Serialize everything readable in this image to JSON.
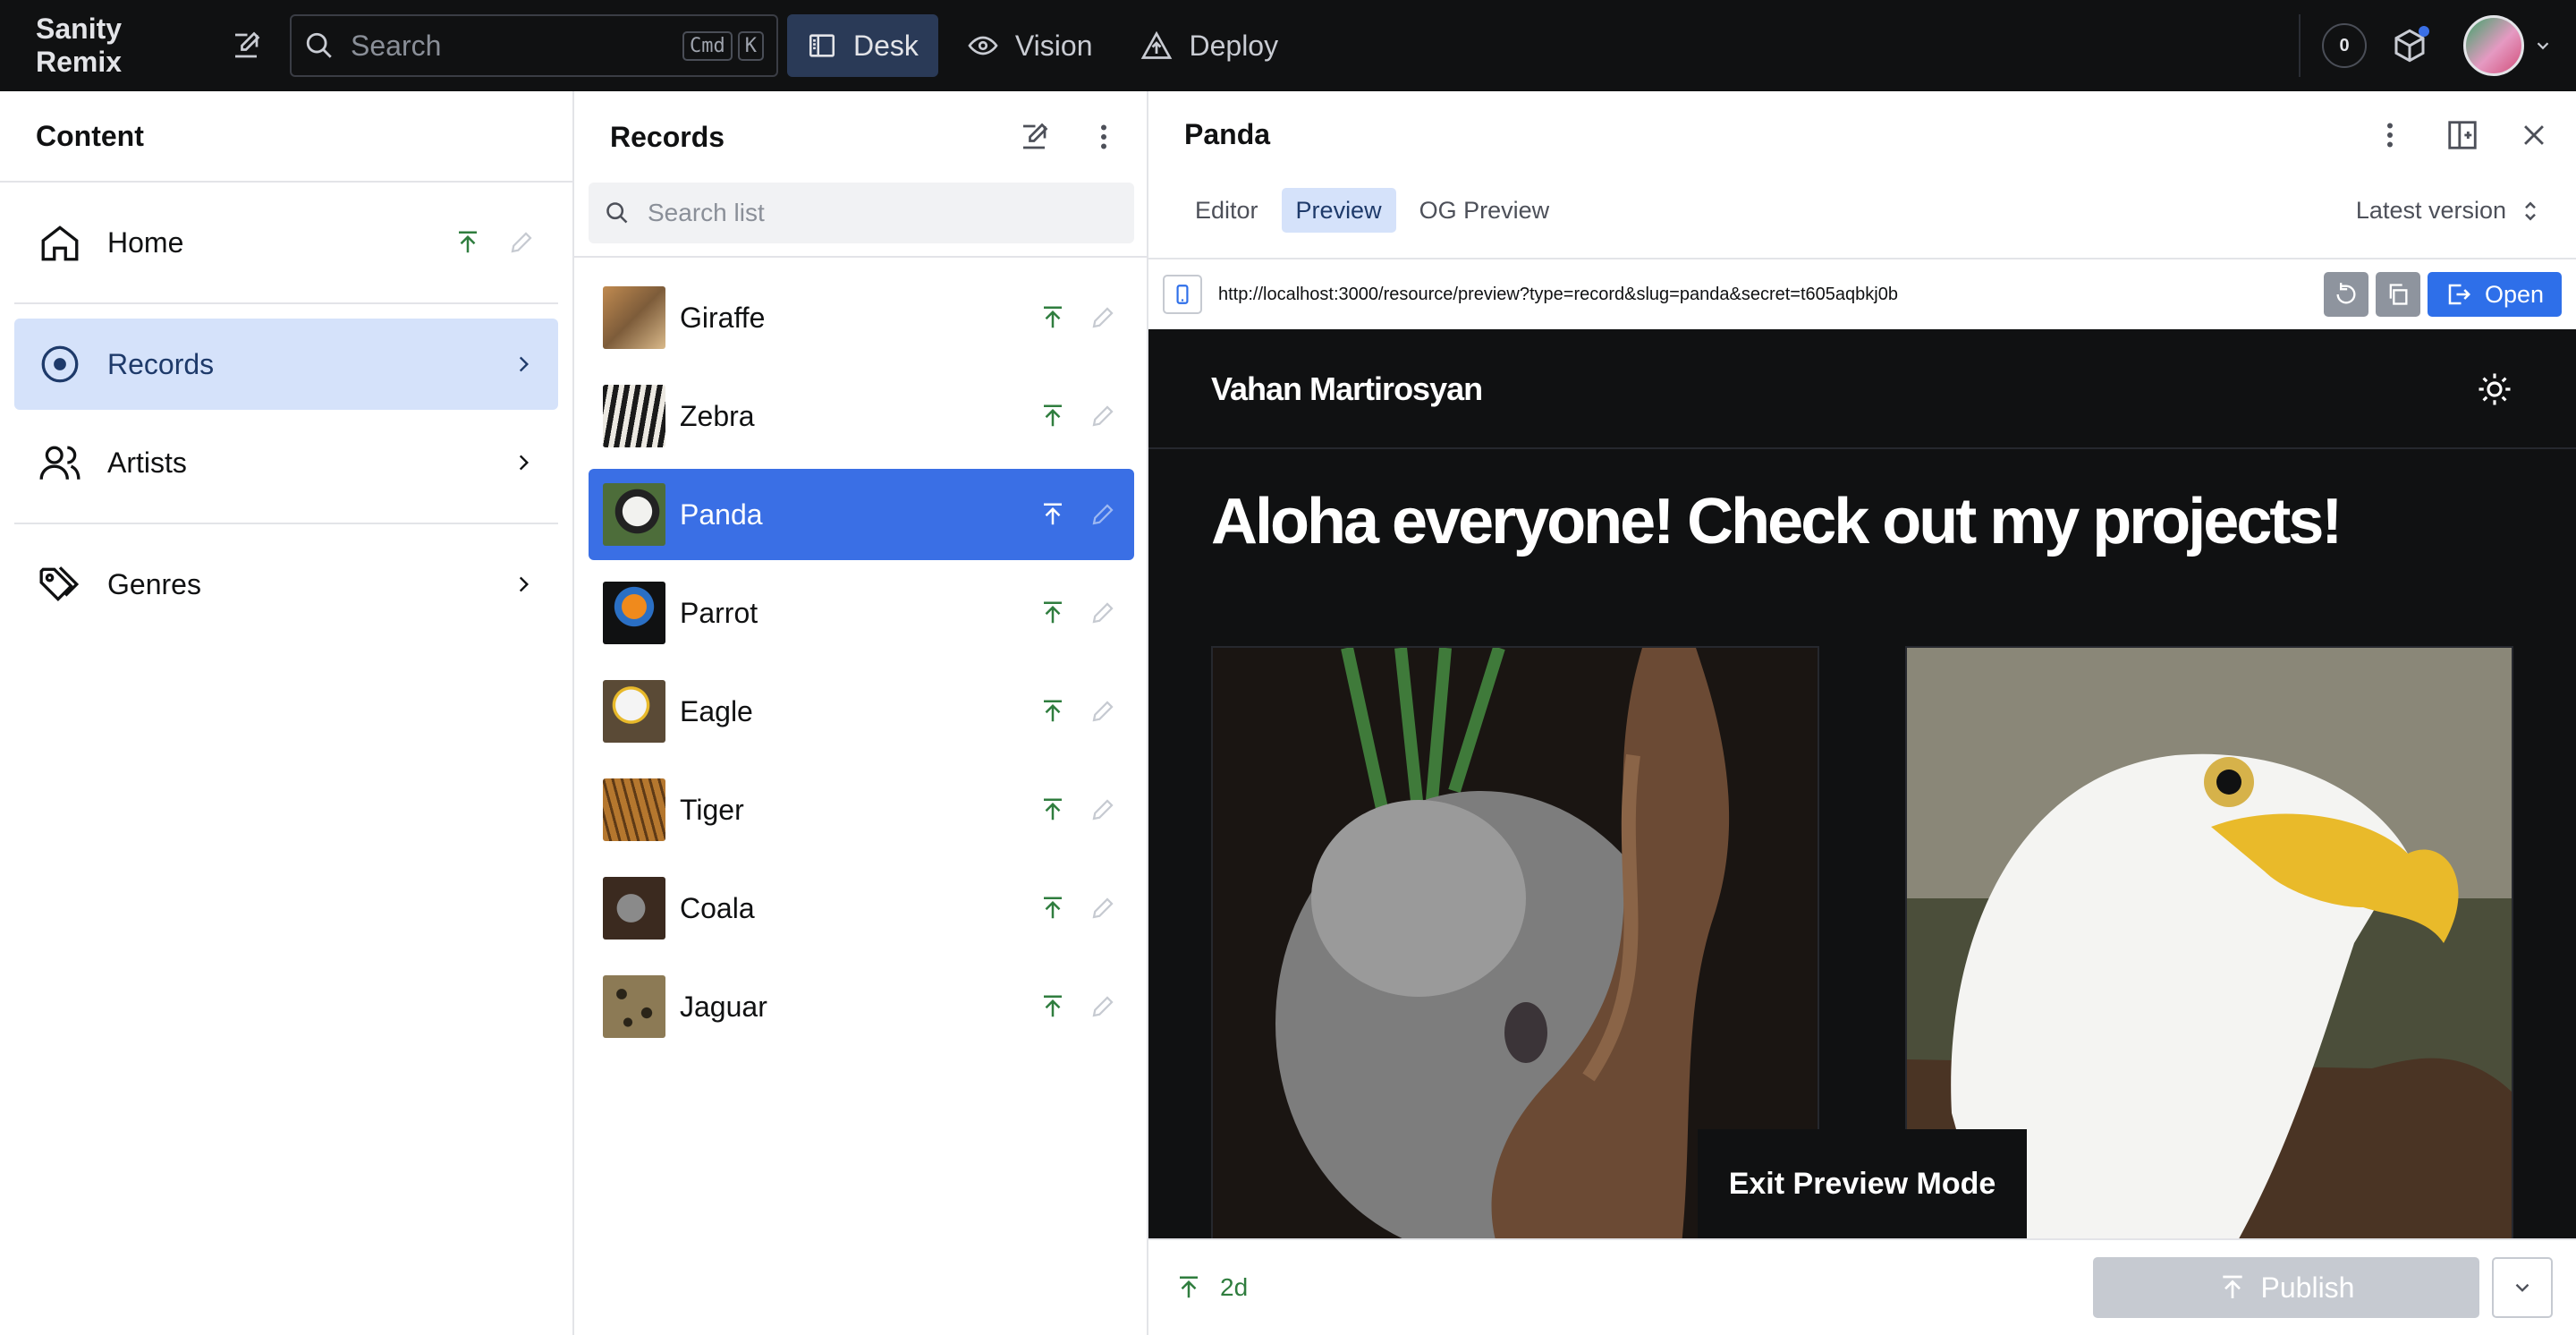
{
  "app": {
    "brand": "Sanity Remix",
    "search_placeholder": "Search",
    "shortcut_1": "Cmd",
    "shortcut_2": "K",
    "nav": [
      "Desk",
      "Vision",
      "Deploy"
    ],
    "notification_count": "0"
  },
  "content_pane": {
    "title": "Content",
    "items": [
      {
        "label": "Home",
        "icon": "home-icon"
      },
      {
        "label": "Records",
        "icon": "record-icon"
      },
      {
        "label": "Artists",
        "icon": "users-icon"
      },
      {
        "label": "Genres",
        "icon": "tags-icon"
      }
    ]
  },
  "records_pane": {
    "title": "Records",
    "search_placeholder": "Search list",
    "items": [
      "Giraffe",
      "Zebra",
      "Panda",
      "Parrot",
      "Eagle",
      "Tiger",
      "Coala",
      "Jaguar"
    ],
    "selected": "Panda"
  },
  "document_pane": {
    "title": "Panda",
    "tabs": [
      "Editor",
      "Preview",
      "OG Preview"
    ],
    "active_tab": "Preview",
    "version": "Latest version",
    "url": "http://localhost:3000/resource/preview?type=record&slug=panda&secret=t605aqbkj0b",
    "open_label": "Open",
    "preview": {
      "name": "Vahan Martirosyan",
      "headline": "Aloha everyone! Check out my projects!",
      "exit_label": "Exit Preview Mode"
    },
    "footer": {
      "time": "2d",
      "publish_label": "Publish"
    }
  },
  "colors": {
    "accent": "#3a6fe5",
    "published": "#2f7d3e",
    "topbar": "#101112"
  }
}
